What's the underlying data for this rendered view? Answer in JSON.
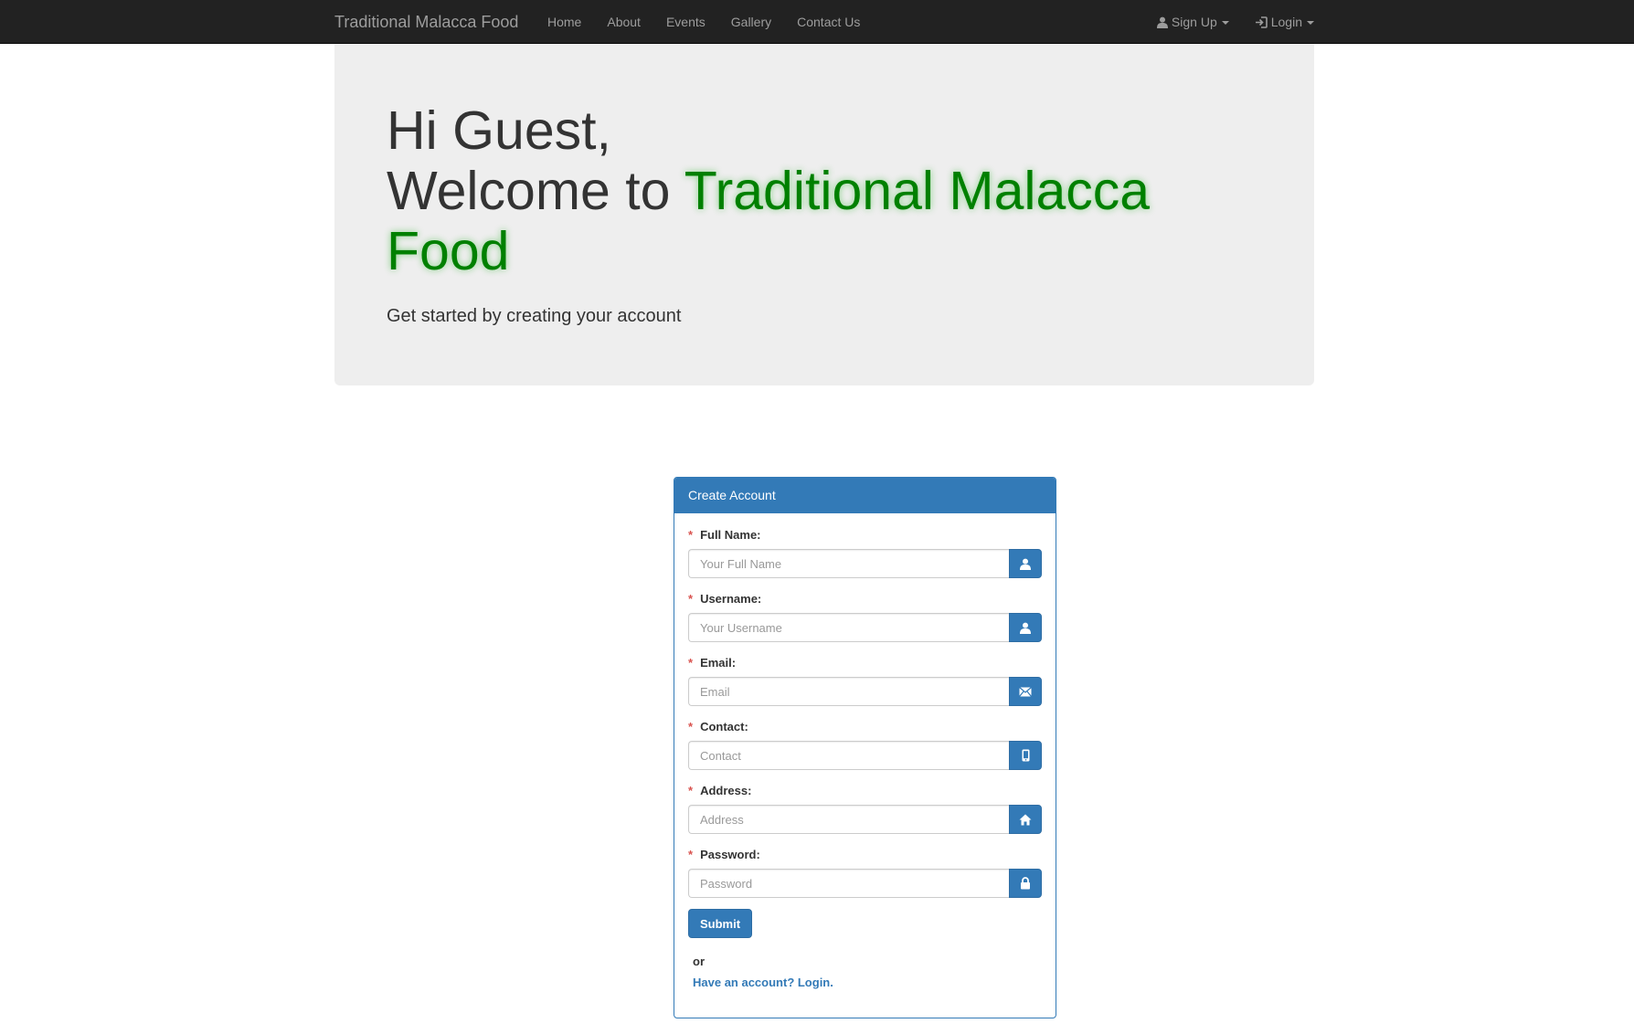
{
  "navbar": {
    "brand": "Traditional Malacca Food",
    "links": [
      "Home",
      "About",
      "Events",
      "Gallery",
      "Contact Us"
    ],
    "signup_label": "Sign Up",
    "login_label": "Login"
  },
  "jumbotron": {
    "line1": "Hi Guest,",
    "line2_prefix": "Welcome to ",
    "brand_highlight": "Traditional Malacca Food",
    "lead": "Get started by creating your account"
  },
  "form": {
    "panel_title": "Create Account",
    "required_mark": "*",
    "fields": [
      {
        "label": "Full Name:",
        "placeholder": "Your Full Name",
        "icon": "user-icon"
      },
      {
        "label": "Username:",
        "placeholder": "Your Username",
        "icon": "user-icon"
      },
      {
        "label": "Email:",
        "placeholder": "Email",
        "icon": "envelope-icon"
      },
      {
        "label": "Contact:",
        "placeholder": "Contact",
        "icon": "phone-icon"
      },
      {
        "label": "Address:",
        "placeholder": "Address",
        "icon": "home-icon"
      },
      {
        "label": "Password:",
        "placeholder": "Password",
        "icon": "lock-icon"
      }
    ],
    "submit_label": "Submit",
    "or_text": "or",
    "login_link": "Have an account? Login."
  },
  "colors": {
    "navbar_bg": "#222222",
    "primary": "#337ab7",
    "brand_green": "#008000",
    "jumbotron_bg": "#eeeeee",
    "required": "#d9534f"
  }
}
